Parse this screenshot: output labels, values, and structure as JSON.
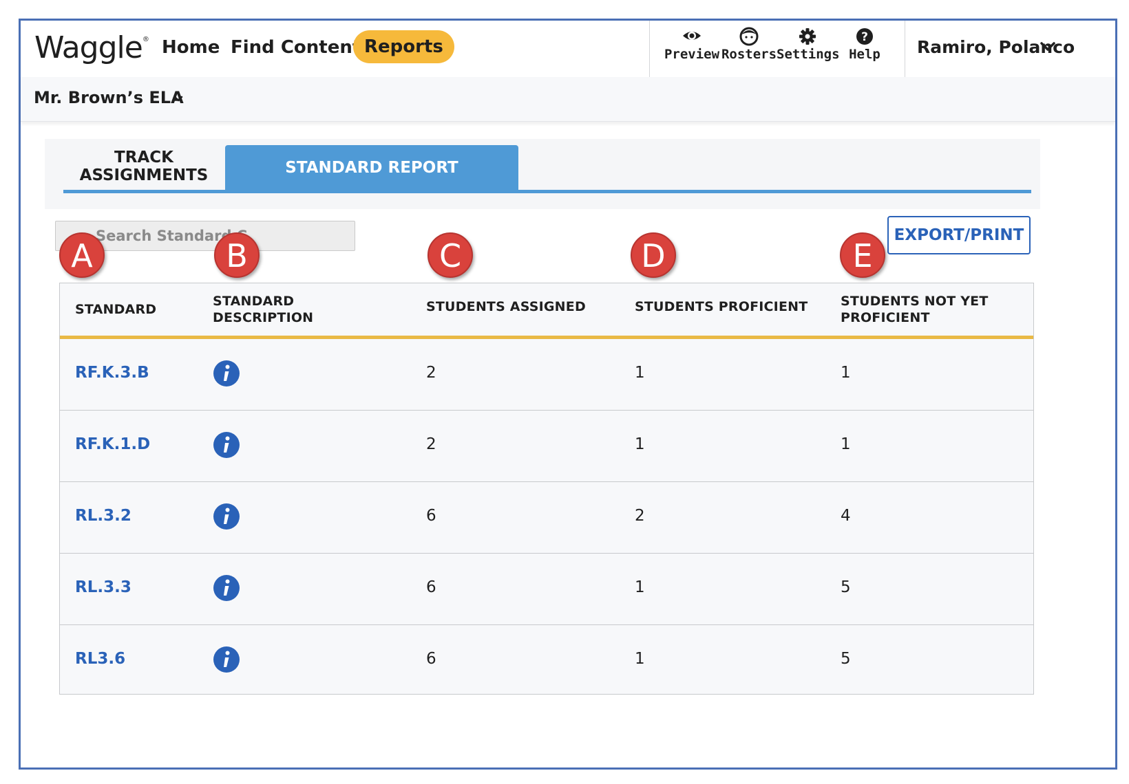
{
  "app": {
    "logo": "Waggle",
    "logo_mark": "®"
  },
  "nav": {
    "home": "Home",
    "find_content": "Find Content",
    "reports": "Reports",
    "active_color": "#f6b93b"
  },
  "tools": [
    {
      "label": "Preview",
      "icon": "eye-icon"
    },
    {
      "label": "Rosters",
      "icon": "face-icon"
    },
    {
      "label": "Settings",
      "icon": "gear-icon"
    },
    {
      "label": "Help",
      "icon": "help-icon"
    }
  ],
  "user": {
    "name": "Ramiro, Polanco"
  },
  "class_selector": {
    "value": "Mr. Brown’s ELA"
  },
  "tabs": [
    {
      "label_line1": "TRACK",
      "label_line2": "ASSIGNMENTS",
      "active": false
    },
    {
      "label": "STANDARD REPORT",
      "active": true
    }
  ],
  "search": {
    "placeholder": "Search Standard C"
  },
  "export_label": "EXPORT/PRINT",
  "callouts": [
    "A",
    "B",
    "C",
    "D",
    "E"
  ],
  "table": {
    "headers": {
      "standard": "STANDARD",
      "description_line1": "STANDARD",
      "description_line2": "DESCRIPTION",
      "assigned": "STUDENTS ASSIGNED",
      "proficient": "STUDENTS PROFICIENT",
      "not_yet_line1": "STUDENTS NOT YET",
      "not_yet_line2": "PROFICIENT"
    },
    "rows": [
      {
        "standard": "RF.K.3.B",
        "assigned": "2",
        "proficient": "1",
        "not_yet": "1"
      },
      {
        "standard": "RF.K.1.D",
        "assigned": "2",
        "proficient": "1",
        "not_yet": "1"
      },
      {
        "standard": "RL.3.2",
        "assigned": "6",
        "proficient": "2",
        "not_yet": "4"
      },
      {
        "standard": "RL.3.3",
        "assigned": "6",
        "proficient": "1",
        "not_yet": "5"
      },
      {
        "standard": "RL3.6",
        "assigned": "6",
        "proficient": "1",
        "not_yet": "5"
      }
    ]
  },
  "colors": {
    "link_blue": "#2a62b8",
    "tab_blue": "#4f9ad6",
    "callout_red": "#d9423c",
    "header_rule": "#e9b945"
  }
}
